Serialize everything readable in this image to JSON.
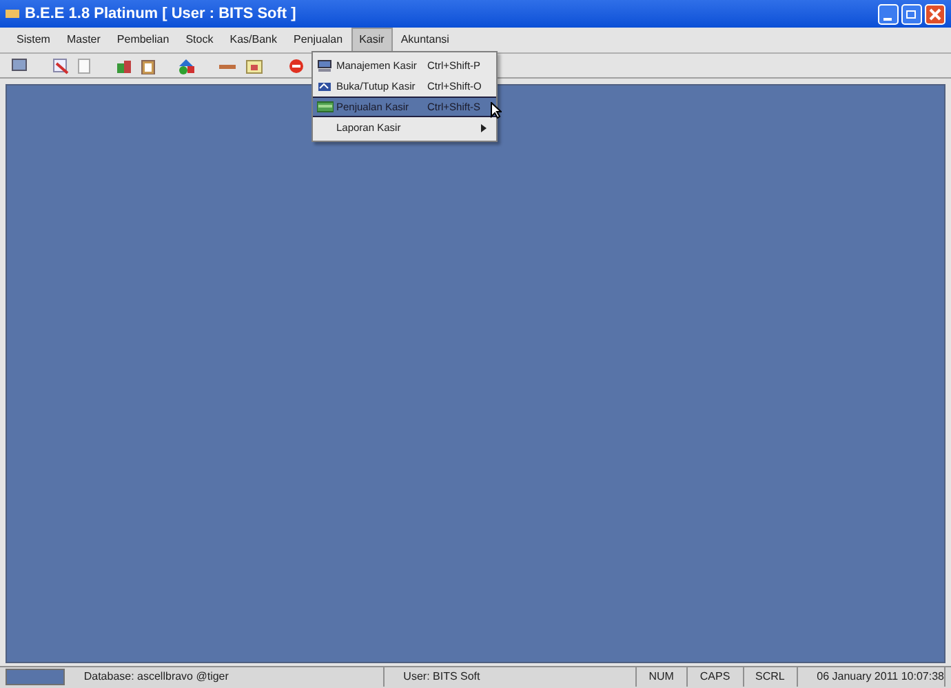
{
  "window": {
    "title": "B.E.E 1.8 Platinum [ User : BITS Soft ]"
  },
  "menu_bar": [
    {
      "label": "Sistem",
      "selected": false
    },
    {
      "label": "Master",
      "selected": false
    },
    {
      "label": "Pembelian",
      "selected": false
    },
    {
      "label": "Stock",
      "selected": false
    },
    {
      "label": "Kas/Bank",
      "selected": false
    },
    {
      "label": "Penjualan",
      "selected": false
    },
    {
      "label": "Kasir",
      "selected": true
    },
    {
      "label": "Akuntansi",
      "selected": false
    }
  ],
  "dropdown": [
    {
      "kind": "item",
      "label": "Manajemen Kasir",
      "shortcut": "Ctrl+Shift-P",
      "selected": false
    },
    {
      "kind": "item",
      "label": "Buka/Tutup Kasir",
      "shortcut": "Ctrl+Shift-O",
      "selected": false
    },
    {
      "kind": "item",
      "label": "Penjualan Kasir",
      "shortcut": "Ctrl+Shift-S",
      "selected": true
    },
    {
      "kind": "submenu",
      "label": "Laporan Kasir",
      "selected": false
    }
  ],
  "status_bar": [
    {
      "kind": "progress"
    },
    {
      "kind": "text",
      "text": "Database: ascellbravo @tiger"
    },
    {
      "kind": "text",
      "text": "User: BITS Soft"
    },
    {
      "kind": "key",
      "text": "NUM"
    },
    {
      "kind": "key",
      "text": "CAPS"
    },
    {
      "kind": "key",
      "text": "SCRL"
    },
    {
      "kind": "text",
      "text": "06 January 2011  10:07:38"
    }
  ]
}
